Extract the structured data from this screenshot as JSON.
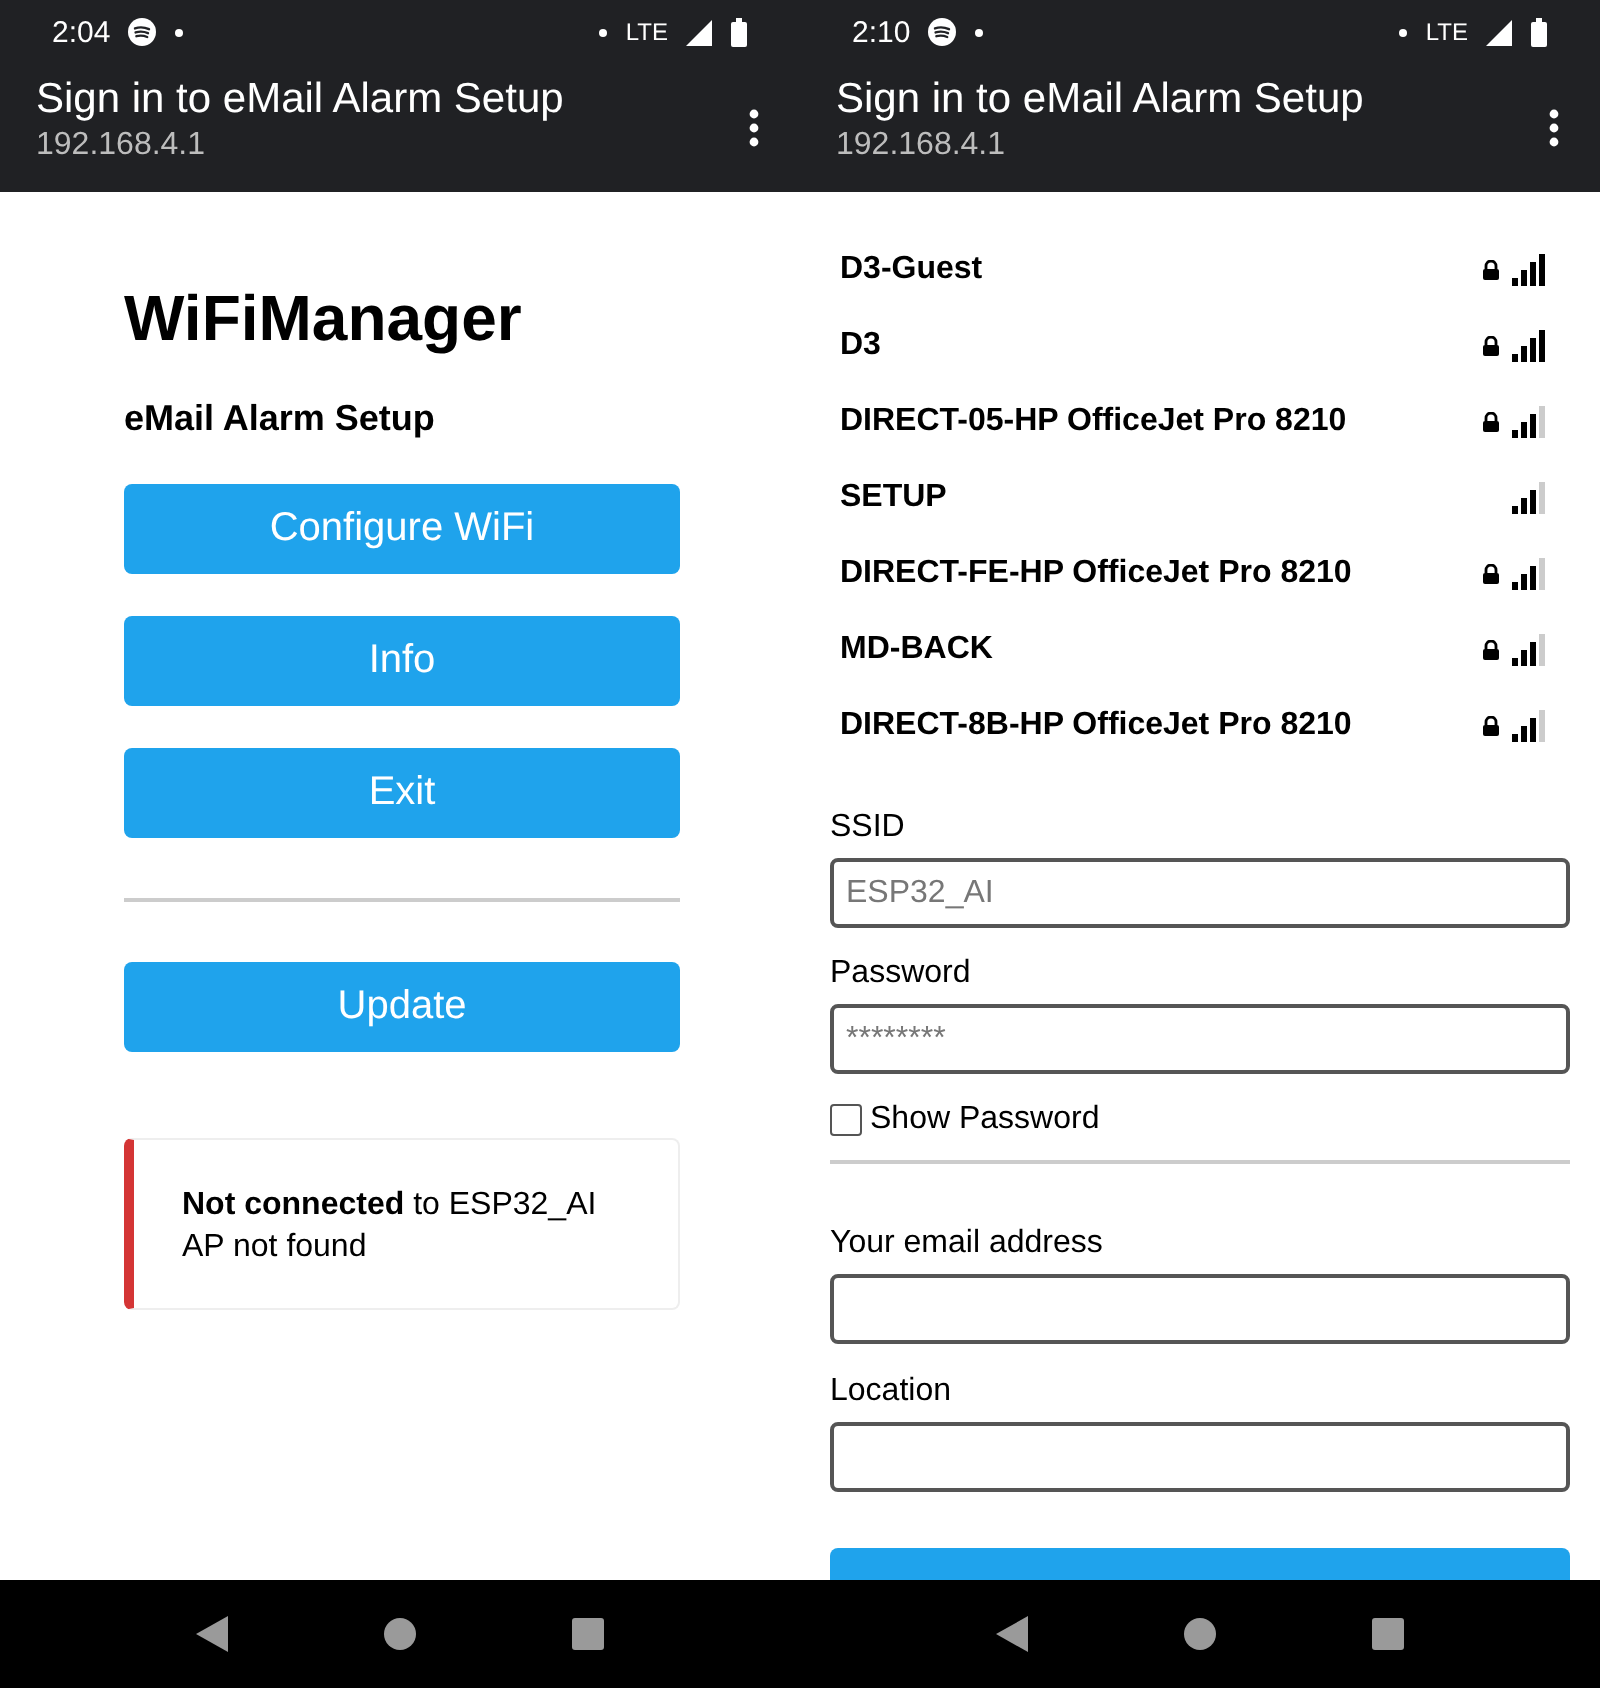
{
  "screens": [
    {
      "status_bar": {
        "time": "2:04",
        "network": "LTE"
      },
      "app_bar": {
        "title": "Sign in to eMail Alarm Setup",
        "url": "192.168.4.1"
      },
      "kind": "menu",
      "heading": "WiFiManager",
      "subtitle": "eMail Alarm Setup",
      "buttons": [
        "Configure WiFi",
        "Info",
        "Exit"
      ],
      "update_button": "Update",
      "message": {
        "line_1": "**Not connected** to ESP32_AI",
        "line_2": "AP not found"
      }
    },
    {
      "status_bar": {
        "time": "2:10",
        "network": "LTE"
      },
      "app_bar": {
        "title": "Sign in to eMail Alarm Setup",
        "url": "192.168.4.1"
      },
      "kind": "wifi_form",
      "networks": [
        {
          "name": "D3-Guest",
          "secured": true,
          "kind": "full"
        },
        {
          "name": "D3",
          "secured": true,
          "kind": "full"
        },
        {
          "name": "DIRECT-05-HP OfficeJet Pro 8210",
          "secured": true,
          "kind": "good"
        },
        {
          "name": "SETUP",
          "secured": false,
          "kind": "good"
        },
        {
          "name": "DIRECT-FE-HP OfficeJet Pro 8210",
          "secured": true,
          "kind": "good"
        },
        {
          "name": "MD-BACK",
          "secured": true,
          "kind": "good"
        },
        {
          "name": "DIRECT-8B-HP OfficeJet Pro 8210",
          "secured": true,
          "kind": "good"
        }
      ],
      "ssid": {
        "label": "SSID",
        "placeholder": "ESP32_AI"
      },
      "password": {
        "label": "Password",
        "placeholder": "********"
      },
      "show_password": {
        "label": "Show Password",
        "checked": false
      },
      "email": {
        "label": "Your email address"
      },
      "location": {
        "label": "Location"
      }
    }
  ]
}
